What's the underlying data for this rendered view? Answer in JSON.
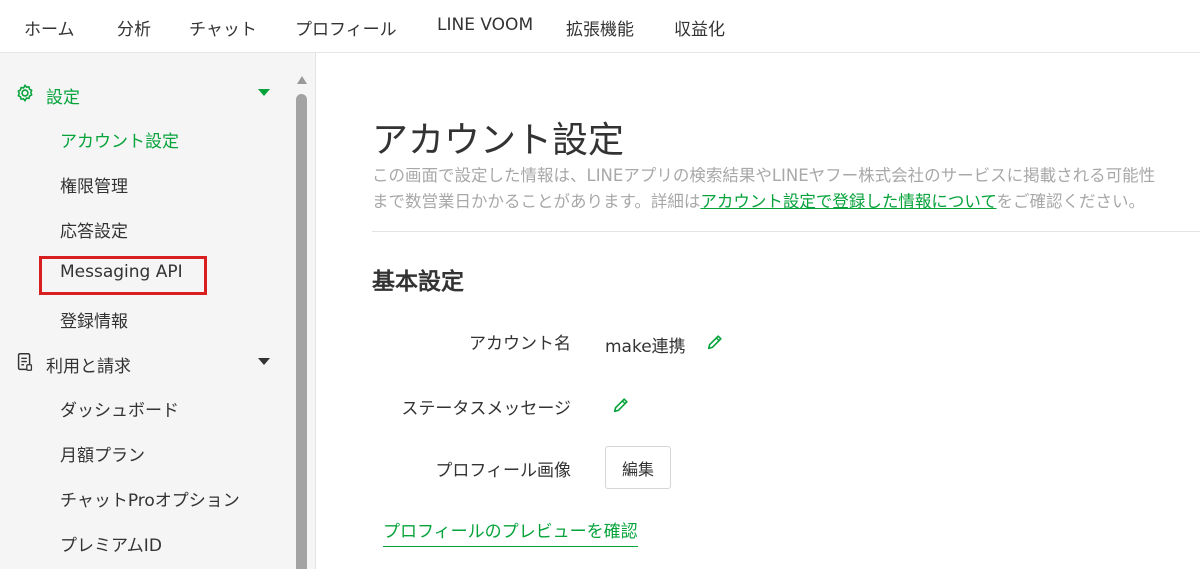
{
  "topnav": {
    "items": [
      "ホーム",
      "分析",
      "チャット",
      "プロフィール",
      "LINE VOOM",
      "拡張機能",
      "収益化"
    ]
  },
  "sidebar": {
    "settings": {
      "label": "設定",
      "icon": "gear-icon",
      "expanded": true,
      "items": [
        "アカウント設定",
        "権限管理",
        "応答設定",
        "Messaging API",
        "登録情報"
      ],
      "active_item": "アカウント設定",
      "highlighted_item": "Messaging API"
    },
    "billing": {
      "label": "利用と請求",
      "icon": "document-icon",
      "expanded": true,
      "items": [
        "ダッシュボード",
        "月額プラン",
        "チャットProオプション",
        "プレミアムID"
      ]
    }
  },
  "main": {
    "title": "アカウント設定",
    "description": {
      "line1": "この画面で設定した情報は、LINEアプリの検索結果やLINEヤフー株式会社のサービスに掲載される可能性",
      "line2_prefix": "まで数営業日かかることがあります。詳細は",
      "link": "アカウント設定で登録した情報について",
      "line2_suffix": "をご確認ください。"
    },
    "basic": {
      "title": "基本設定",
      "account_name_label": "アカウント名",
      "account_name_value": "make連携",
      "status_label": "ステータスメッセージ",
      "status_value": "",
      "profile_image_label": "プロフィール画像",
      "edit_button": "編集",
      "preview_link": "プロフィールのプレビューを確認"
    }
  },
  "colors": {
    "accent": "#06a33b",
    "highlight_border": "#d81e1e",
    "sidebar_bg": "#f5f5f5",
    "muted_text": "#a8a8a8"
  }
}
